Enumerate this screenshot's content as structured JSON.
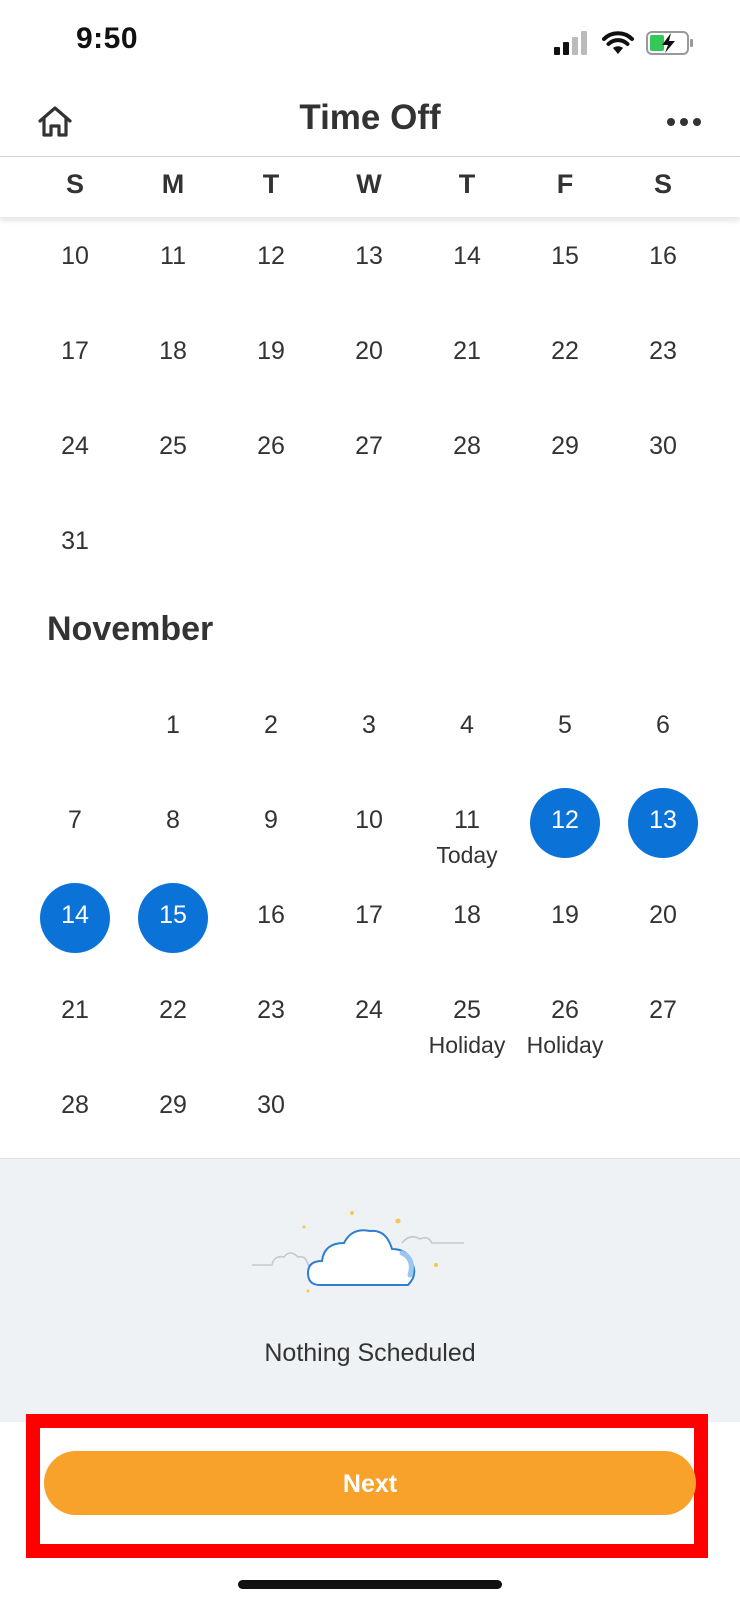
{
  "status_bar": {
    "time": "9:50",
    "icons": [
      "cellular-signal-icon",
      "wifi-icon",
      "battery-charging-icon"
    ]
  },
  "header": {
    "title": "Time Off",
    "home_icon": "home-icon",
    "more_icon": "more-icon"
  },
  "weekdays": [
    "S",
    "M",
    "T",
    "W",
    "T",
    "F",
    "S"
  ],
  "calendar": {
    "previous_month_rows": [
      [
        "10",
        "11",
        "12",
        "13",
        "14",
        "15",
        "16"
      ],
      [
        "17",
        "18",
        "19",
        "20",
        "21",
        "22",
        "23"
      ],
      [
        "24",
        "25",
        "26",
        "27",
        "28",
        "29",
        "30"
      ],
      [
        "31"
      ]
    ],
    "month_title": "November",
    "november_days": [
      {
        "day": "1",
        "col": 1,
        "row": 0
      },
      {
        "day": "2",
        "col": 2,
        "row": 0
      },
      {
        "day": "3",
        "col": 3,
        "row": 0
      },
      {
        "day": "4",
        "col": 4,
        "row": 0
      },
      {
        "day": "5",
        "col": 5,
        "row": 0
      },
      {
        "day": "6",
        "col": 6,
        "row": 0
      },
      {
        "day": "7",
        "col": 0,
        "row": 1
      },
      {
        "day": "8",
        "col": 1,
        "row": 1
      },
      {
        "day": "9",
        "col": 2,
        "row": 1
      },
      {
        "day": "10",
        "col": 3,
        "row": 1
      },
      {
        "day": "11",
        "col": 4,
        "row": 1,
        "label": "Today"
      },
      {
        "day": "12",
        "col": 5,
        "row": 1,
        "selected": true
      },
      {
        "day": "13",
        "col": 6,
        "row": 1,
        "selected": true
      },
      {
        "day": "14",
        "col": 0,
        "row": 2,
        "selected": true
      },
      {
        "day": "15",
        "col": 1,
        "row": 2,
        "selected": true
      },
      {
        "day": "16",
        "col": 2,
        "row": 2
      },
      {
        "day": "17",
        "col": 3,
        "row": 2
      },
      {
        "day": "18",
        "col": 4,
        "row": 2
      },
      {
        "day": "19",
        "col": 5,
        "row": 2
      },
      {
        "day": "20",
        "col": 6,
        "row": 2
      },
      {
        "day": "21",
        "col": 0,
        "row": 3
      },
      {
        "day": "22",
        "col": 1,
        "row": 3
      },
      {
        "day": "23",
        "col": 2,
        "row": 3
      },
      {
        "day": "24",
        "col": 3,
        "row": 3
      },
      {
        "day": "25",
        "col": 4,
        "row": 3,
        "label": "Holiday"
      },
      {
        "day": "26",
        "col": 5,
        "row": 3,
        "label": "Holiday"
      },
      {
        "day": "27",
        "col": 6,
        "row": 3
      },
      {
        "day": "28",
        "col": 0,
        "row": 4
      },
      {
        "day": "29",
        "col": 1,
        "row": 4
      },
      {
        "day": "30",
        "col": 2,
        "row": 4
      }
    ]
  },
  "schedule": {
    "empty_text": "Nothing Scheduled",
    "illustration": "cloud-icon"
  },
  "footer": {
    "next_label": "Next"
  },
  "colors": {
    "selected_day": "#0b73d8",
    "next_button": "#f8a12b",
    "highlight": "#ff0000",
    "panel_bg": "#eff2f5"
  }
}
